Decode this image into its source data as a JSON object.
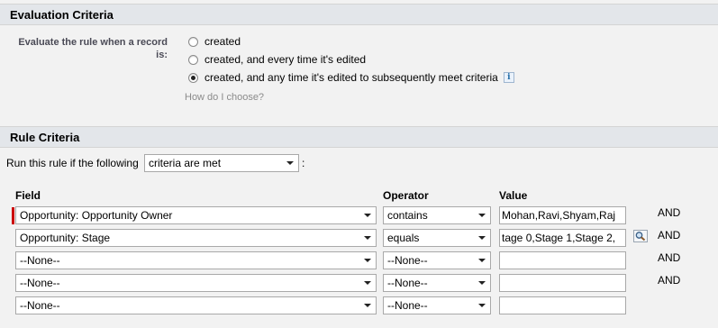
{
  "evaluation": {
    "header": "Evaluation Criteria",
    "label": "Evaluate the rule when a record is:",
    "options": [
      {
        "label": "created",
        "selected": false
      },
      {
        "label": "created, and every time it's edited",
        "selected": false
      },
      {
        "label": "created, and any time it's edited to subsequently meet criteria",
        "selected": true
      }
    ],
    "info_icon": "info-icon",
    "help_link": "How do I choose?"
  },
  "rule": {
    "header": "Rule Criteria",
    "run_label": "Run this rule if the following",
    "criteria_select": "criteria are met",
    "colon": ":",
    "columns": {
      "field": "Field",
      "operator": "Operator",
      "value": "Value"
    },
    "rows": [
      {
        "field": "Opportunity: Opportunity Owner",
        "operator": "contains",
        "value": "Mohan,Ravi,Shyam,Raj",
        "conjunction": "AND",
        "lookup": false,
        "required": true
      },
      {
        "field": "Opportunity: Stage",
        "operator": "equals",
        "value": "tage 0,Stage 1,Stage 2,",
        "conjunction": "AND",
        "lookup": true,
        "required": false
      },
      {
        "field": "--None--",
        "operator": "--None--",
        "value": "",
        "conjunction": "AND",
        "lookup": false,
        "required": false
      },
      {
        "field": "--None--",
        "operator": "--None--",
        "value": "",
        "conjunction": "AND",
        "lookup": false,
        "required": false
      },
      {
        "field": "--None--",
        "operator": "--None--",
        "value": "",
        "conjunction": "",
        "lookup": false,
        "required": false
      }
    ]
  }
}
